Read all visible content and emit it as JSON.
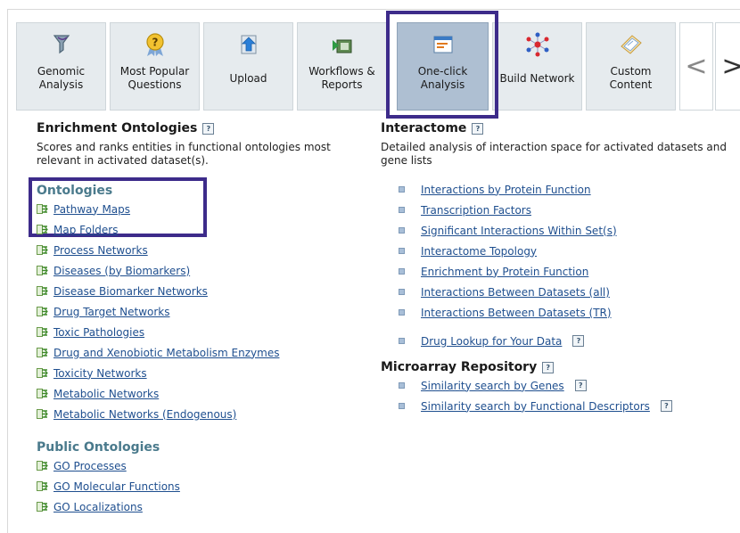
{
  "toolbar": {
    "buttons": [
      {
        "label": "Genomic\nAnalysis",
        "icon": "genomic-analysis-icon"
      },
      {
        "label": "Most Popular\nQuestions",
        "icon": "question-medal-icon"
      },
      {
        "label": "Upload",
        "icon": "upload-arrow-icon"
      },
      {
        "label": "Workflows &\nReports",
        "icon": "workflow-report-icon"
      },
      {
        "label": "One-click\nAnalysis",
        "icon": "one-click-analysis-icon",
        "active": true
      },
      {
        "label": "Build Network",
        "icon": "network-icon"
      },
      {
        "label": "Custom\nContent",
        "icon": "custom-content-icon"
      }
    ],
    "prev_glyph": "<",
    "next_glyph": ">"
  },
  "enrichment": {
    "title": "Enrichment Ontologies",
    "description": "Scores and ranks entities in functional ontologies most relevant in activated dataset(s).",
    "ontologies_heading": "Ontologies",
    "ontologies": [
      "Pathway Maps",
      "Map Folders",
      "Process Networks",
      "Diseases (by Biomarkers)",
      "Disease Biomarker Networks",
      "Drug Target Networks",
      "Toxic Pathologies",
      "Drug and Xenobiotic Metabolism Enzymes",
      "Toxicity Networks",
      "Metabolic Networks",
      "Metabolic Networks (Endogenous)"
    ],
    "public_heading": "Public Ontologies",
    "public_ontologies": [
      "GO Processes",
      "GO Molecular Functions",
      "GO Localizations"
    ]
  },
  "interactome": {
    "title": "Interactome",
    "description": "Detailed analysis of interaction space for activated datasets and gene lists",
    "links": [
      "Interactions by Protein Function",
      "Transcription Factors",
      "Significant Interactions Within Set(s)",
      "Interactome Topology",
      "Enrichment by Protein Function",
      "Interactions Between Datasets (all)",
      "Interactions Between Datasets (TR)"
    ],
    "drug_lookup": "Drug Lookup for Your Data"
  },
  "microarray": {
    "title": "Microarray Repository",
    "links": [
      "Similarity search by Genes",
      "Similarity search by Functional Descriptors"
    ]
  },
  "colors": {
    "highlight": "#3d2b8a",
    "link": "#1f4f8f",
    "subheading": "#4a7a8c",
    "toolbar_bg": "#e6ebee",
    "toolbar_active": "#aebfd2"
  }
}
